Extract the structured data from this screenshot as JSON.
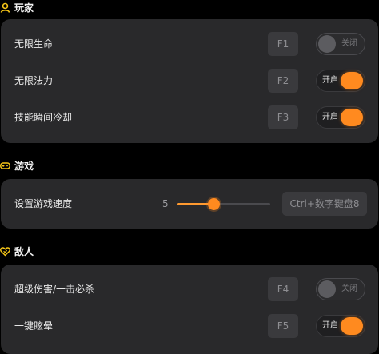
{
  "colors": {
    "accent": "#ff8a1f",
    "section_icon": "#f5c518",
    "card_bg": "#29292b",
    "page_bg": "#000000"
  },
  "sections": {
    "player": {
      "title": "玩家",
      "icon": "user-icon",
      "rows": [
        {
          "label": "无限生命",
          "hotkey": "F1",
          "toggle_state": "off",
          "toggle_text": "关闭"
        },
        {
          "label": "无限法力",
          "hotkey": "F2",
          "toggle_state": "on",
          "toggle_text": "开启"
        },
        {
          "label": "技能瞬间冷却",
          "hotkey": "F3",
          "toggle_state": "on",
          "toggle_text": "开启"
        }
      ]
    },
    "game": {
      "title": "游戏",
      "icon": "gamepad-icon",
      "speed": {
        "label": "设置游戏速度",
        "value": "5",
        "fill_fraction": 0.39,
        "hotkey": "Ctrl+数字键盘8"
      }
    },
    "enemy": {
      "title": "敌人",
      "icon": "heart-icon",
      "rows": [
        {
          "label": "超级伤害/一击必杀",
          "hotkey": "F4",
          "toggle_state": "off",
          "toggle_text": "关闭"
        },
        {
          "label": "一键眩晕",
          "hotkey": "F5",
          "toggle_state": "on",
          "toggle_text": "开启"
        }
      ]
    }
  }
}
